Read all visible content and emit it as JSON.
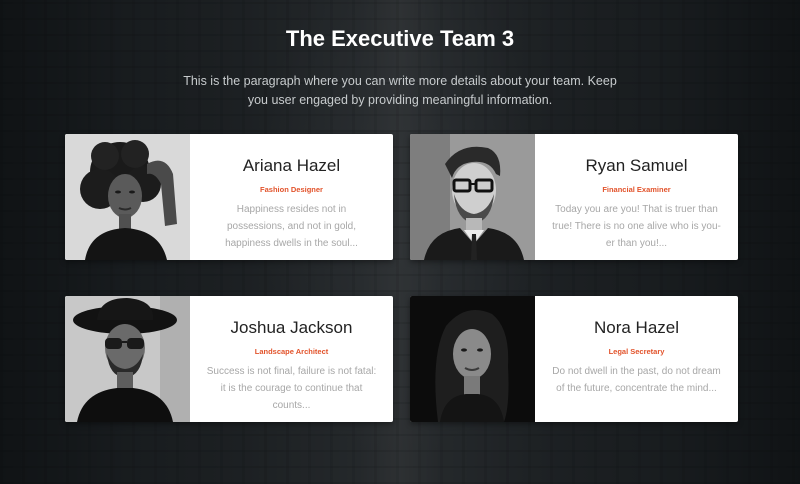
{
  "section": {
    "title": "The Executive Team 3",
    "intro": "This is the paragraph where you can write more details about your team. Keep you user engaged by providing meaningful information."
  },
  "members": [
    {
      "name": "Ariana Hazel",
      "role": "Fashion Designer",
      "bio": "Happiness resides not in possessions, and not in gold, happiness dwells in the soul...",
      "photo": "portrait-woman-curly-hair"
    },
    {
      "name": "Ryan Samuel",
      "role": "Financial Examiner",
      "bio": "Today you are you! That is truer than true! There is no one alive who is you-er than you!...",
      "photo": "portrait-man-glasses-suit"
    },
    {
      "name": "Joshua Jackson",
      "role": "Landscape Architect",
      "bio": "Success is not final, failure is not fatal: it is the courage to continue that counts...",
      "photo": "portrait-man-hat-sunglasses"
    },
    {
      "name": "Nora Hazel",
      "role": "Legal Secretary",
      "bio": "Do not dwell in the past, do not dream of the future, concentrate the mind...",
      "photo": "portrait-woman-dark-hair"
    }
  ],
  "colors": {
    "accent": "#e2532b",
    "card_background": "#ffffff",
    "name_text": "#222222",
    "bio_text": "#a7a7a7",
    "page_background": "#1e2326"
  }
}
